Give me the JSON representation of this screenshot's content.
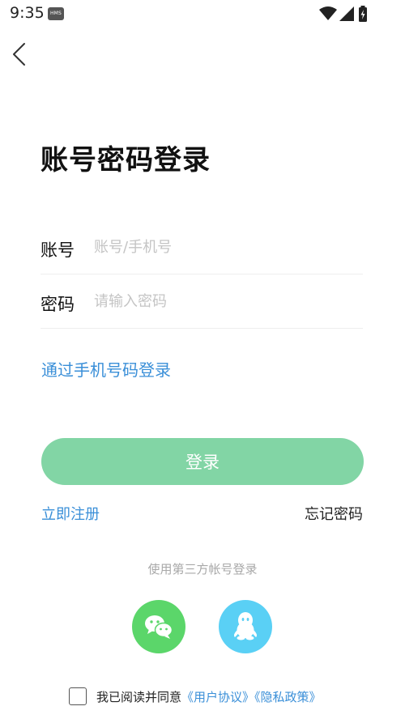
{
  "status_bar": {
    "time": "9:35",
    "badge": "HMS",
    "icons": [
      "wifi-icon",
      "signal-icon",
      "battery-charging-icon"
    ]
  },
  "back_icon": "chevron-left-icon",
  "title": "账号密码登录",
  "account_field": {
    "label": "账号",
    "placeholder": "账号/手机号",
    "value": ""
  },
  "password_field": {
    "label": "密码",
    "placeholder": "请输入密码",
    "value": ""
  },
  "phone_login_link": "通过手机号码登录",
  "login_button": "登录",
  "register_link": "立即注册",
  "forgot_link": "忘记密码",
  "third_party_label": "使用第三方帐号登录",
  "social": [
    {
      "name": "wechat",
      "icon": "wechat-icon",
      "color": "#5bd66a"
    },
    {
      "name": "qq",
      "icon": "qq-penguin-icon",
      "color": "#5ad0f5"
    }
  ],
  "agreement": {
    "checked": false,
    "text": "我已阅读并同意",
    "user_agreement": "《用户协议》",
    "privacy_policy": "《隐私政策》"
  },
  "colors": {
    "accent_blue": "#3a8fd8",
    "login_button": "#82d5a5",
    "wechat_green": "#5bd66a",
    "qq_blue": "#5ad0f5"
  }
}
